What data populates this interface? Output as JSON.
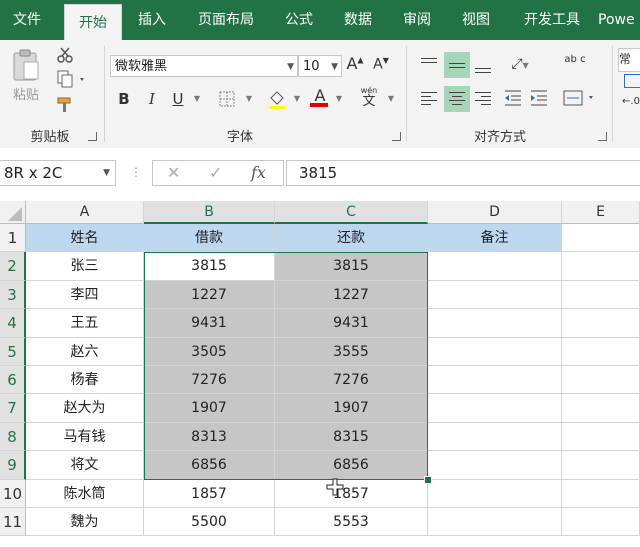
{
  "tabs": [
    {
      "label": "文件"
    },
    {
      "label": "开始"
    },
    {
      "label": "插入"
    },
    {
      "label": "页面布局"
    },
    {
      "label": "公式"
    },
    {
      "label": "数据"
    },
    {
      "label": "审阅"
    },
    {
      "label": "视图"
    },
    {
      "label": "开发工具"
    },
    {
      "label": "Powe"
    }
  ],
  "ribbon": {
    "clipboard": {
      "paste_label": "粘贴",
      "group_label": "剪贴板"
    },
    "font": {
      "font_name": "微软雅黑",
      "font_size": "10",
      "group_label": "字体",
      "bold": "B",
      "italic": "I",
      "underline": "U",
      "font_color_glyph": "A",
      "phonetic_top": "wén",
      "phonetic_bottom": "文",
      "grow": "A",
      "shrink": "A"
    },
    "alignment": {
      "group_label": "对齐方式",
      "wrap_text": "ab c"
    },
    "cut_off": {
      "label": "常"
    }
  },
  "formula_bar": {
    "name_box": "8R x 2C",
    "fx": "fx",
    "value": "3815"
  },
  "colors": {
    "accent": "#217346",
    "header_fill": "#bdd7ee",
    "selection_fill": "#c6c6c6"
  },
  "sheet": {
    "columns": [
      "A",
      "B",
      "C",
      "D",
      "E"
    ],
    "rows": [
      "1",
      "2",
      "3",
      "4",
      "5",
      "6",
      "7",
      "8",
      "9",
      "10",
      "11"
    ],
    "header": [
      "姓名",
      "借款",
      "还款",
      "备注"
    ],
    "data": [
      [
        "张三",
        "3815",
        "3815"
      ],
      [
        "李四",
        "1227",
        "1227"
      ],
      [
        "王五",
        "9431",
        "9431"
      ],
      [
        "赵六",
        "3505",
        "3555"
      ],
      [
        "杨春",
        "7276",
        "7276"
      ],
      [
        "赵大为",
        "1907",
        "1907"
      ],
      [
        "马有钱",
        "8313",
        "8315"
      ],
      [
        "将文",
        "6856",
        "6856"
      ],
      [
        "陈水筒",
        "1857",
        "1857"
      ],
      [
        "魏为",
        "5500",
        "5553"
      ]
    ]
  }
}
